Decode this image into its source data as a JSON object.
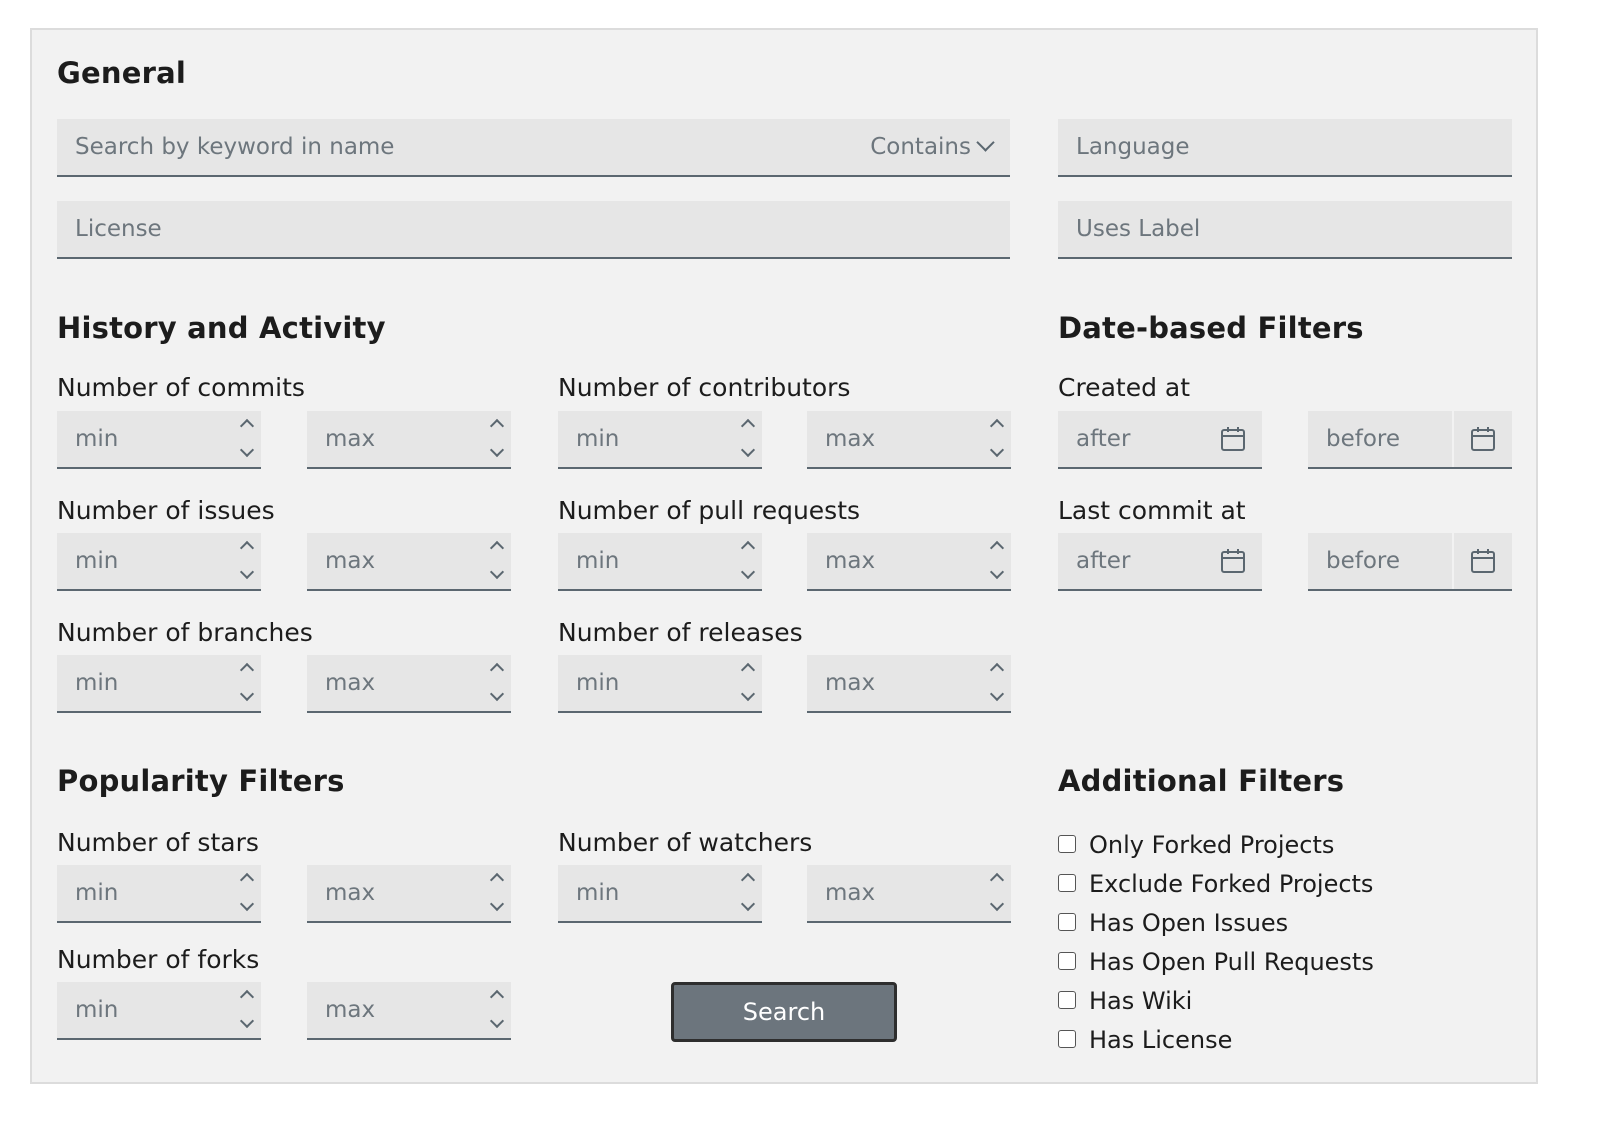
{
  "general": {
    "title": "General",
    "keyword_placeholder": "Search by keyword in name",
    "match_mode": "Contains",
    "language_placeholder": "Language",
    "license_placeholder": "License",
    "uses_label_placeholder": "Uses Label"
  },
  "history": {
    "title": "History and Activity",
    "commits": "Number of commits",
    "contributors": "Number of contributors",
    "issues": "Number of issues",
    "pull_requests": "Number of pull requests",
    "branches": "Number of branches",
    "releases": "Number of releases"
  },
  "dates": {
    "title": "Date-based Filters",
    "created": "Created at",
    "last_commit": "Last commit at",
    "after_placeholder": "after",
    "before_placeholder": "before"
  },
  "popularity": {
    "title": "Popularity Filters",
    "stars": "Number of stars",
    "watchers": "Number of watchers",
    "forks": "Number of forks"
  },
  "range": {
    "min_placeholder": "min",
    "max_placeholder": "max"
  },
  "additional": {
    "title": "Additional Filters",
    "options": [
      {
        "label": "Only Forked Projects",
        "checked": false
      },
      {
        "label": "Exclude Forked Projects",
        "checked": false
      },
      {
        "label": "Has Open Issues",
        "checked": false
      },
      {
        "label": "Has Open Pull Requests",
        "checked": false
      },
      {
        "label": "Has Wiki",
        "checked": false
      },
      {
        "label": "Has License",
        "checked": false
      }
    ]
  },
  "search_button": "Search"
}
